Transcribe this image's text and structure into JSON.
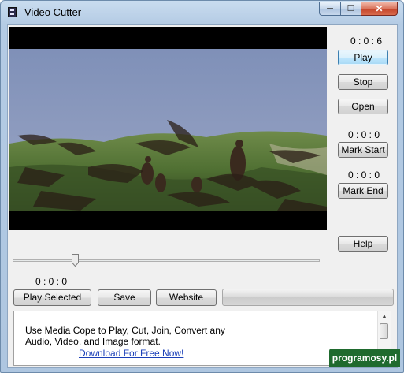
{
  "window": {
    "title": "Video Cutter",
    "icon": "film-icon",
    "controls": {
      "minimize": "─",
      "maximize": "☐",
      "close": "✕"
    }
  },
  "controls": {
    "time_display": "0 : 0 : 6",
    "play": "Play",
    "stop": "Stop",
    "open": "Open",
    "mark_start_time": "0 : 0 : 0",
    "mark_start": "Mark Start",
    "mark_end_time": "0 : 0 : 0",
    "mark_end": "Mark End",
    "help": "Help"
  },
  "timeline": {
    "position_time": "0 : 0 : 0"
  },
  "bottom_bar": {
    "play_selected": "Play Selected",
    "save": "Save",
    "website": "Website"
  },
  "info": {
    "text": "Use Media Cope to Play, Cut, Join, Convert any Audio, Video, and Image format.",
    "link": "Download For Free Now!"
  },
  "watermark": "programosy.pl",
  "colors": {
    "accent": "#3c7fb1",
    "link": "#1a3fb8",
    "badge": "#1f6a2e"
  }
}
